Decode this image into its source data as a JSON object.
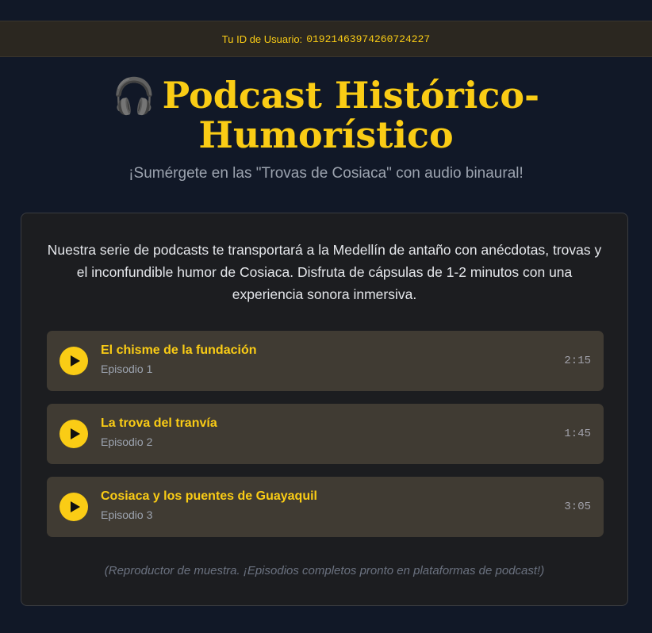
{
  "userbar": {
    "label": "Tu ID de Usuario:",
    "user_id": "01921463974260724227"
  },
  "header": {
    "icon": "headphones-icon",
    "emoji": "🎧",
    "title": "Podcast Histórico-Humorístico",
    "subtitle": "¡Sumérgete en las \"Trovas de Cosiaca\" con audio binaural!"
  },
  "main": {
    "intro": "Nuestra serie de podcasts te transportará a la Medellín de antaño con anécdotas, trovas y el inconfundible humor de Cosiaca. Disfruta de cápsulas de 1-2 minutos con una experiencia sonora inmersiva.",
    "episodes": [
      {
        "title": "El chisme de la fundación",
        "subtitle": "Episodio 1",
        "duration": "2:15"
      },
      {
        "title": "La trova del tranvía",
        "subtitle": "Episodio 2",
        "duration": "1:45"
      },
      {
        "title": "Cosiaca y los puentes de Guayaquil",
        "subtitle": "Episodio 3",
        "duration": "3:05"
      }
    ],
    "note": "(Reproductor de muestra. ¡Episodios completos pronto en plataformas de podcast!)"
  },
  "colors": {
    "background": "#111827",
    "accent": "#facc15",
    "card": "#1c1d20",
    "episode_bg": "#403b33"
  }
}
